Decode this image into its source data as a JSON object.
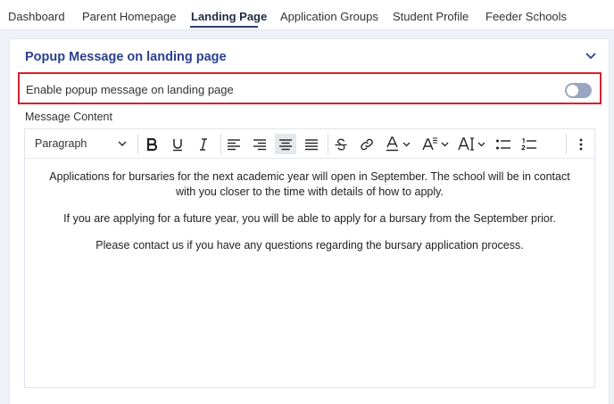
{
  "tabs": [
    {
      "label": "Dashboard"
    },
    {
      "label": "Parent Homepage"
    },
    {
      "label": "Landing Page"
    },
    {
      "label": "Application Groups"
    },
    {
      "label": "Student Profile"
    },
    {
      "label": "Feeder Schools"
    }
  ],
  "active_tab": "Landing Page",
  "section": {
    "title": "Popup Message on landing page",
    "enable_label": "Enable popup message on landing page",
    "enable_value": false,
    "message_label": "Message Content"
  },
  "editor": {
    "paragraph_style": "Paragraph",
    "toolbar_icons": [
      "bold-icon",
      "underline-icon",
      "italic-icon",
      "align-left-icon",
      "align-right-icon",
      "align-center-icon",
      "align-justify-icon",
      "strikethrough-icon",
      "link-icon",
      "font-color-icon",
      "font-size-icon",
      "text-transform-icon",
      "bullet-list-icon",
      "numbered-list-icon",
      "more-options-icon"
    ],
    "content": [
      "Applications for bursaries for the next academic year will open in September. The school will be in contact with you closer to the time with details of how to apply.",
      "If you are applying for a future year, you will be able to apply for a bursary from the September prior.",
      "Please contact us if you have any questions regarding the bursary application process."
    ]
  },
  "colors": {
    "section_title": "#2b3f8c",
    "highlight_border": "#d5202e",
    "toggle_off": "#9aa6c1",
    "active_tab_underline": "#2e3f6e"
  }
}
